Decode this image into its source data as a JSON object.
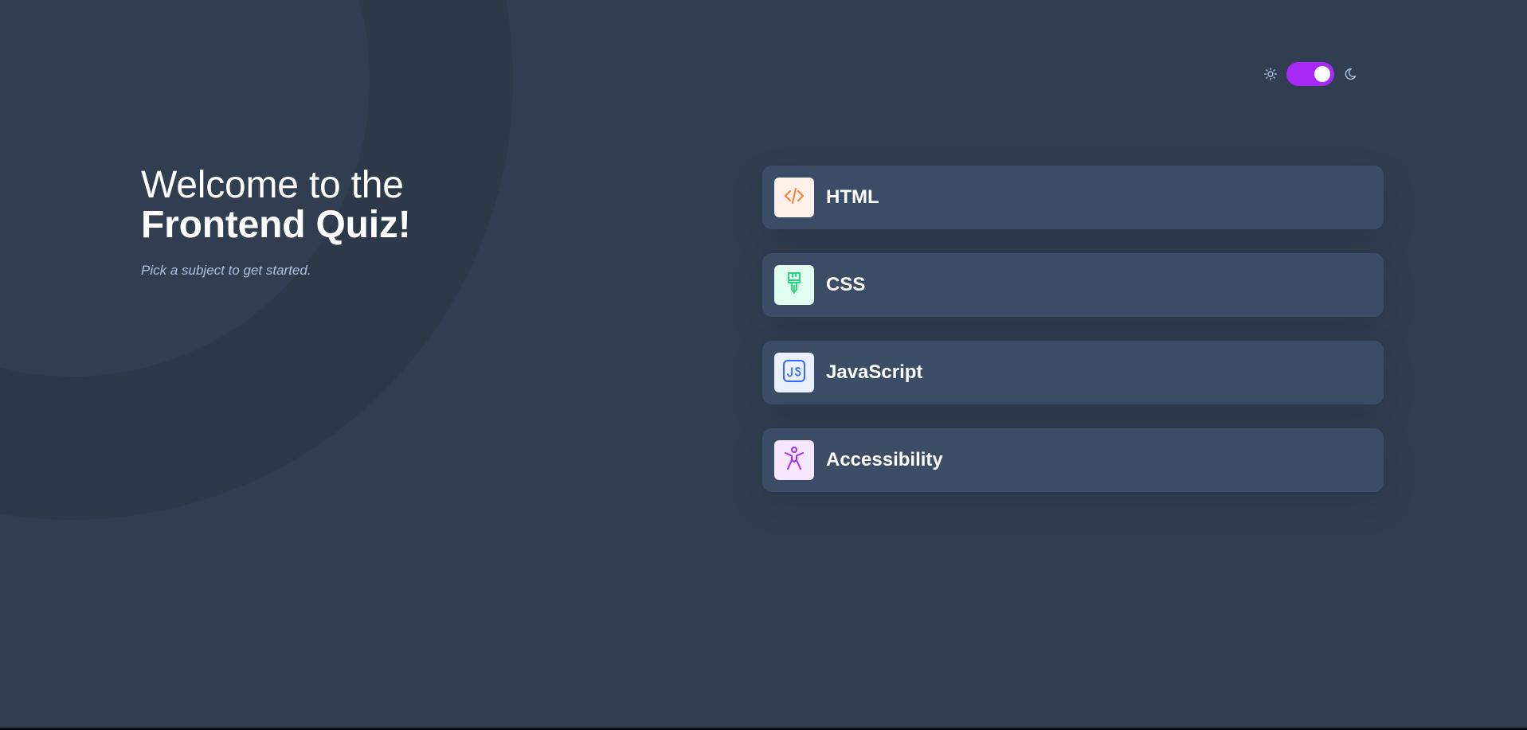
{
  "heading": {
    "line1": "Welcome to the",
    "line2": "Frontend Quiz!"
  },
  "subtitle": "Pick a subject to get started.",
  "theme": {
    "light_icon": "sun-icon",
    "dark_icon": "moon-icon",
    "mode": "dark",
    "switch_color": "#a729f5"
  },
  "subjects": [
    {
      "label": "HTML",
      "icon": "code-brackets-icon",
      "icon_color": "#ff7e35",
      "icon_bg": "#fff1e9"
    },
    {
      "label": "CSS",
      "icon": "paintbrush-icon",
      "icon_color": "#26d782",
      "icon_bg": "#e0fdef"
    },
    {
      "label": "JavaScript",
      "icon": "js-icon",
      "icon_color": "#306aff",
      "icon_bg": "#ebf0ff"
    },
    {
      "label": "Accessibility",
      "icon": "accessibility-person-icon",
      "icon_color": "#a729f5",
      "icon_bg": "#f6e7ff"
    }
  ],
  "colors": {
    "background": "#313e51",
    "card": "#3b4d66",
    "subtitle": "#abc1e1",
    "accent": "#a729f5"
  }
}
